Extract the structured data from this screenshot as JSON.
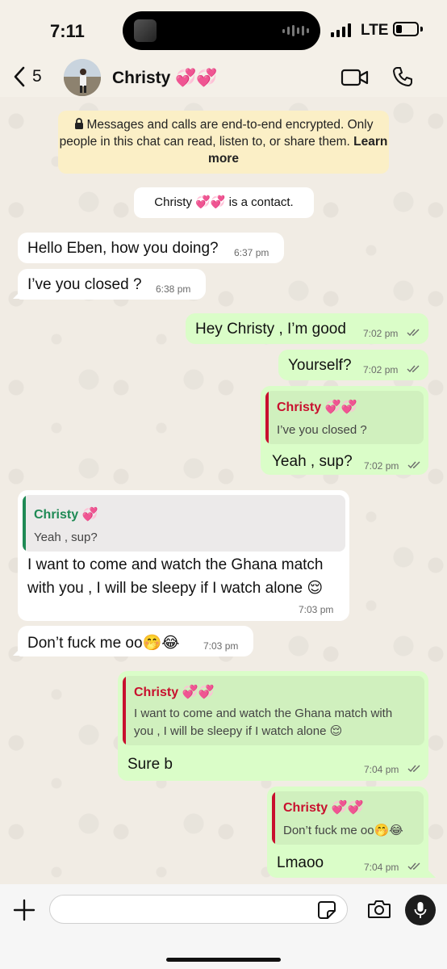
{
  "status_bar": {
    "time": "7:11",
    "network": "LTE",
    "battery_level": 0.3
  },
  "header": {
    "back_count": "5",
    "contact_name": "Christy 💞💞",
    "icons": [
      "chevron-left-icon",
      "video-call-icon",
      "phone-icon"
    ]
  },
  "notices": {
    "encryption_text": "Messages and calls are end-to-end encrypted. Only people in this chat can read, listen to, or share them.",
    "encryption_link": "Learn more",
    "contact_notice": "Christy 💞💞 is a contact."
  },
  "messages": [
    {
      "direction": "in",
      "text": "Hello Eben, how you doing?",
      "time": "6:37 pm"
    },
    {
      "direction": "in",
      "text": "I’ve you closed ?",
      "time": "6:38 pm"
    },
    {
      "direction": "out",
      "text": "Hey Christy , I’m good",
      "time": "7:02 pm"
    },
    {
      "direction": "out",
      "text": "Yourself?",
      "time": "7:02 pm"
    },
    {
      "direction": "out",
      "quote_author": "Christy 💞💞",
      "quote_text": "I’ve you closed ?",
      "text": "Yeah , sup?",
      "time": "7:02 pm"
    },
    {
      "direction": "in",
      "quote_author": "Christy 💞",
      "quote_text": "Yeah , sup?",
      "text_line1": "I want to come and watch the Ghana match",
      "text_line2": "with you , I will be sleepy if I watch alone 😌",
      "time": "7:03 pm"
    },
    {
      "direction": "in",
      "text": "Don’t fuck me oo🤭😂",
      "time": "7:03 pm"
    },
    {
      "direction": "out",
      "quote_author": "Christy 💞💞",
      "quote_line1": "I want to come and watch the Ghana match with",
      "quote_line2": "you , I will be sleepy if I watch alone 😌",
      "text": "Sure b",
      "time": "7:04 pm"
    },
    {
      "direction": "out",
      "quote_author": "Christy 💞💞",
      "quote_text": "Don’t fuck me oo🤭😂",
      "text": "Lmaoo",
      "time": "7:04 pm"
    }
  ],
  "input_bar": {
    "placeholder": ""
  },
  "colors": {
    "incoming_bubble": "#ffffff",
    "outgoing_bubble": "#dafdc8",
    "quote_bar_red": "#c8102e",
    "quote_bar_green": "#1f8a55",
    "encryption_bg": "#fbefc6"
  }
}
